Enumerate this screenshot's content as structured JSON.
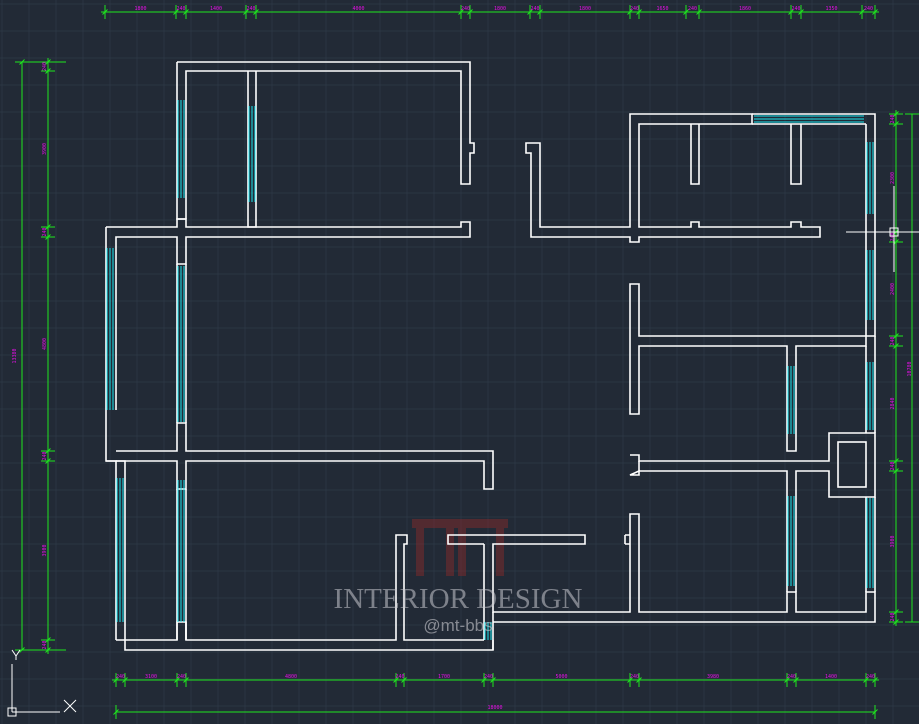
{
  "drawing": {
    "background": "#222a36",
    "wall_color": "#ffffff",
    "window_color": "#19e6f0",
    "dimension_color": "#1ee61e",
    "dimension_text_color": "#e60fe6",
    "grid_color": "#2f3a48"
  },
  "dimensions": {
    "top": [
      "1800",
      "240",
      "1400",
      "240",
      "4000",
      "240",
      "1800",
      "240",
      "1800",
      "240",
      "1650",
      "240",
      "1860",
      "240",
      "1350",
      "240"
    ],
    "bottom": [
      "240",
      "3100",
      "240",
      "4800",
      "240",
      "1700",
      "240",
      "5000",
      "240",
      "3980",
      "240",
      "1400",
      "240"
    ],
    "bottom_total": "18000",
    "left": [
      "240",
      "3900",
      "240",
      "4800",
      "240",
      "3900",
      "240"
    ],
    "left_total": "13380",
    "right": [
      "240",
      "2300",
      "240",
      "2400",
      "240",
      "2840",
      "240",
      "3900",
      "240"
    ],
    "right_total": "10780"
  },
  "watermark": {
    "title": "INTERIOR DESIGN",
    "handle": "@mt-bbs"
  },
  "icons": {
    "ucs": "ucs-axis-icon",
    "crosshair": "crosshair-cursor-icon",
    "logo": "mt-logo-icon"
  }
}
